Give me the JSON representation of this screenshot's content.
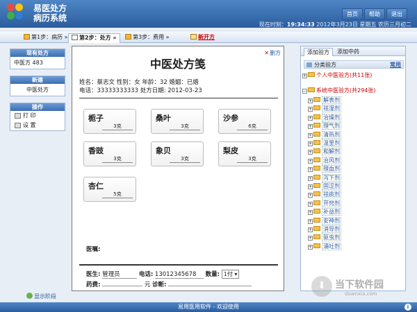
{
  "app": {
    "title_line1": "易医处方",
    "title_line2": "病历系统"
  },
  "nav": {
    "home": "首页",
    "help": "帮助",
    "exit": "退出"
  },
  "status": {
    "label": "现在时刻：",
    "time": "19:34:33",
    "date": "2012年3月23日",
    "weekday": "星期五",
    "lunar": "农历三月初二"
  },
  "steps": [
    {
      "label": "第1步：病历 »"
    },
    {
      "label": "第2步：处方 »"
    },
    {
      "label": "第3步：费用 »"
    },
    {
      "label": "新开方"
    }
  ],
  "left": {
    "current_header": "现有处方",
    "current_value": "中医方 483",
    "new_header": "新建",
    "new_item": "中医处方",
    "ops_header": "操作",
    "print": "打 印",
    "settings": "设 置",
    "show_steps": "显示阶段"
  },
  "rx": {
    "title": "中医处方笺",
    "delete": "删方",
    "patient_line1": "姓名：蔡志文  性别：女  年龄：32  婚姻：已婚",
    "patient_line2": "电话：33333333333  处方日期: 2012-03-23",
    "herbs": [
      {
        "name": "栀子",
        "dose": "3克"
      },
      {
        "name": "桑叶",
        "dose": "3克"
      },
      {
        "name": "沙参",
        "dose": "6克"
      },
      {
        "name": "香豉",
        "dose": "3克"
      },
      {
        "name": "象贝",
        "dose": "3克"
      },
      {
        "name": "梨皮",
        "dose": "3克"
      },
      {
        "name": "杏仁",
        "dose": "5克"
      }
    ],
    "advice_label": "医嘱:",
    "doctor_label": "医生:",
    "doctor": "管理员",
    "phone_label": "电话:",
    "phone": "13012345678",
    "qty_label": "数量:",
    "qty": "1付 ▾",
    "fee_label": "药费:",
    "fee_unit": "元",
    "diag_label": "诊断:"
  },
  "right": {
    "tab1": "添加验方",
    "tab2": "添加中药",
    "cat_label": "分类验方",
    "often": "常用",
    "personal": "个人中医验方(共11张)",
    "system": "系统中医验方(共294张)",
    "items": [
      "解表剂",
      "祛湿剂",
      "治燥剂",
      "理气剂",
      "清热剂",
      "温里剂",
      "和解剂",
      "治风剂",
      "理血剂",
      "泻下剂",
      "固涩剂",
      "祛痰剂",
      "开窍剂",
      "补益剂",
      "安神剂",
      "消导剂",
      "驱虫剂",
      "涌吐剂"
    ]
  },
  "footer": {
    "text": "易用医用软件 - 欢迎使用"
  },
  "watermark": {
    "text": "当下软件园",
    "url": "downxia.com"
  }
}
